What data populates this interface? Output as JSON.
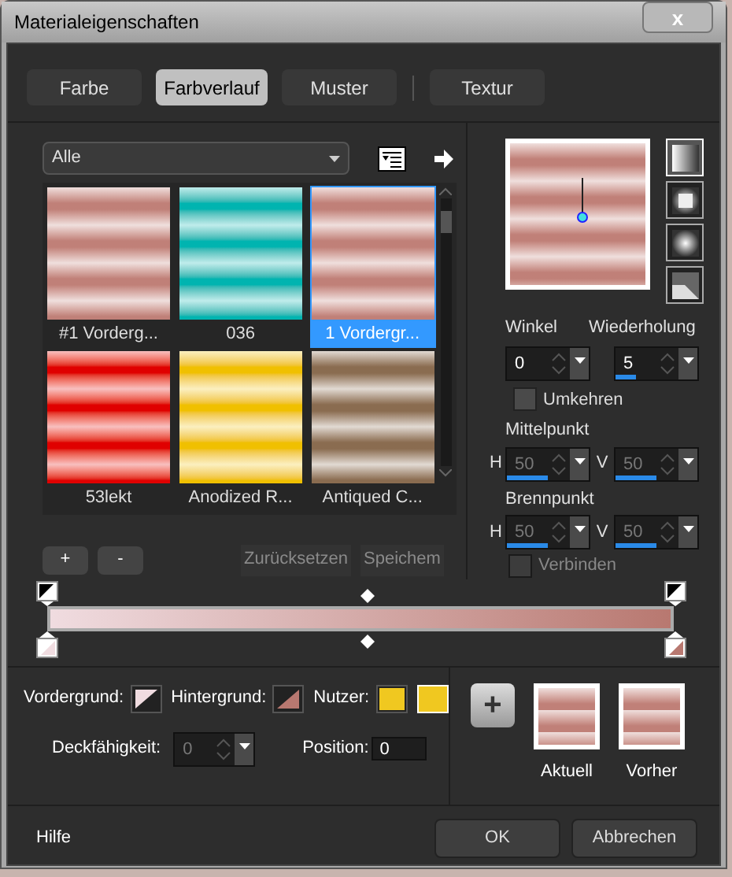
{
  "window": {
    "title": "Materialeigenschaften",
    "close": "x"
  },
  "tabs": [
    {
      "label": "Farbe",
      "selected": false
    },
    {
      "label": "Farbverlauf",
      "selected": true
    },
    {
      "label": "Muster",
      "selected": false
    },
    {
      "label": "Textur",
      "selected": false
    }
  ],
  "filter": {
    "value": "Alle"
  },
  "gradients": [
    {
      "label": "#1 Vorderg...",
      "selected": false,
      "color": "#c08078"
    },
    {
      "label": "036",
      "selected": false,
      "color": "#00b4b0"
    },
    {
      "label": "1 Vordergr...",
      "selected": true,
      "color": "#c08078"
    },
    {
      "label": "53lekt",
      "selected": false,
      "color": "#e00000"
    },
    {
      "label": "Anodized R...",
      "selected": false,
      "color": "#f0c000"
    },
    {
      "label": "Antiqued C...",
      "selected": false,
      "color": "#8a6c50"
    }
  ],
  "style_buttons": [
    {
      "selected": true
    },
    {
      "selected": false
    },
    {
      "selected": false
    },
    {
      "selected": false
    }
  ],
  "angle": {
    "label": "Winkel",
    "value": "0"
  },
  "repeats": {
    "label": "Wiederholung",
    "value": "5",
    "level": 0.25
  },
  "invert": {
    "label": "Umkehren",
    "checked": false
  },
  "center": {
    "label": "Mittelpunkt",
    "h": {
      "label": "H",
      "value": "50",
      "level": 0.5
    },
    "v": {
      "label": "V",
      "value": "50",
      "level": 0.5
    }
  },
  "focus": {
    "label": "Brennpunkt",
    "h": {
      "label": "H",
      "value": "50",
      "level": 0.5
    },
    "v": {
      "label": "V",
      "value": "50",
      "level": 0.5
    }
  },
  "link": {
    "label": "Verbinden",
    "checked": false,
    "disabled": true
  },
  "stop_buttons": [
    "+",
    "-"
  ],
  "reset_button": {
    "label": "Zurücksetzen",
    "disabled": true
  },
  "save_button": {
    "label": "Speichem",
    "disabled": true
  },
  "foreground": {
    "label": "Vordergrund:",
    "color": "#f0dce0"
  },
  "background": {
    "label": "Hintergrund:",
    "color": "#b87870"
  },
  "user": {
    "label": "Nutzer:",
    "color": "#f0c820"
  },
  "opacity": {
    "label": "Deckfähigkeit:",
    "value": "0",
    "disabled": true
  },
  "position": {
    "label": "Position:",
    "value": "0"
  },
  "add_button": "+",
  "current": {
    "label": "Aktuell"
  },
  "previous": {
    "label": "Vorher"
  },
  "help": "Hilfe",
  "ok": "OK",
  "cancel": "Abbrechen"
}
